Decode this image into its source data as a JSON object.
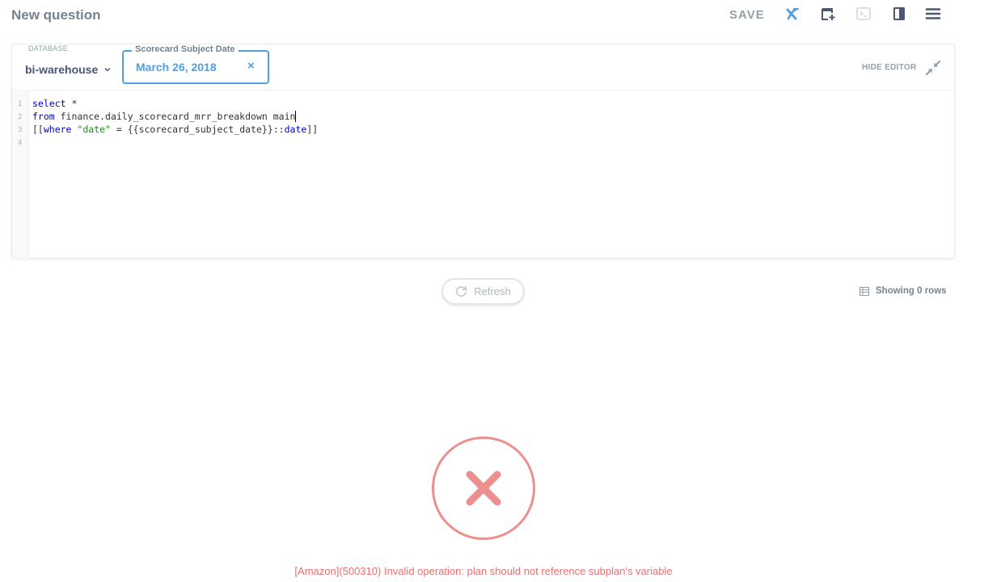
{
  "header": {
    "title": "New question",
    "save_label": "SAVE",
    "icons": [
      "variables-icon",
      "add-to-dashboard-icon",
      "snippet-icon",
      "data-reference-icon",
      "menu-icon"
    ]
  },
  "editor": {
    "database_label": "DATABASE",
    "database_name": "bi-warehouse",
    "parameter": {
      "label": "Scorecard Subject Date",
      "value": "March 26, 2018",
      "clear": "×"
    },
    "hide_editor_label": "HIDE EDITOR",
    "line_numbers": [
      "1",
      "2",
      "3",
      "4"
    ],
    "code": {
      "line1": {
        "keyword": "select",
        "rest": " *"
      },
      "line2": {
        "keyword": "from",
        "rest": " finance.daily_scorecard_mrr_breakdown main"
      },
      "line3": {
        "open": "[[",
        "keyword": "where",
        "space": " ",
        "string": "\"date\"",
        "middle": " = {{scorecard_subject_date}}::",
        "type": "date",
        "close": "]]"
      }
    }
  },
  "results": {
    "refresh_label": "Refresh",
    "row_count": "Showing 0 rows",
    "error_message": "[Amazon](500310) Invalid operation: plan should not reference subplan's variable"
  },
  "colors": {
    "brand": "#509ee3",
    "error": "#ed8f8f",
    "text_dark": "#4c5773",
    "text_muted": "#93a1ab"
  }
}
